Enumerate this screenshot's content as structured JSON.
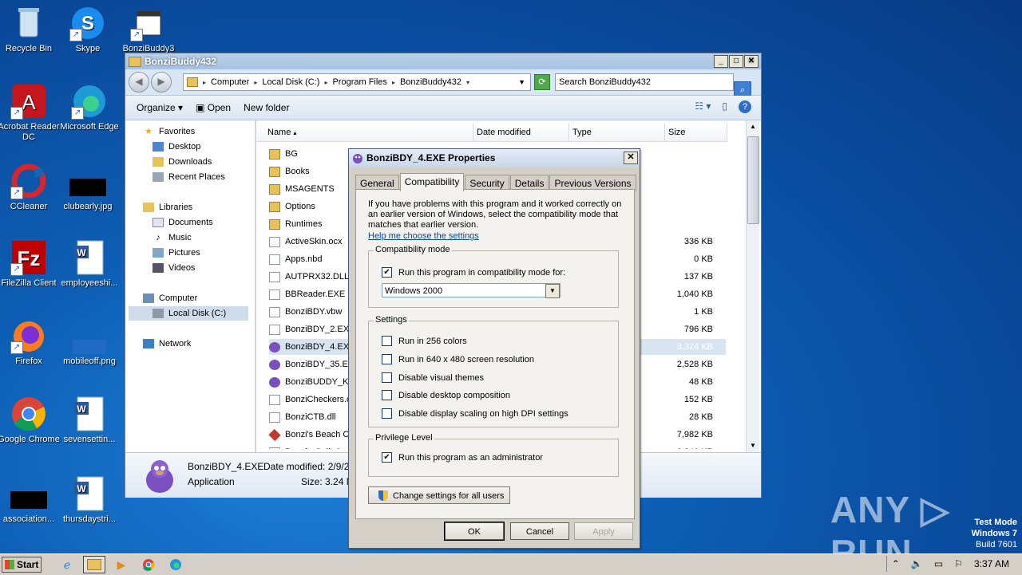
{
  "desktop": {
    "icons": [
      {
        "label": "Recycle Bin"
      },
      {
        "label": "Skype"
      },
      {
        "label": "BonziBuddy3"
      },
      {
        "label": "Acrobat Reader DC"
      },
      {
        "label": "Microsoft Edge"
      },
      {
        "label": "CCleaner"
      },
      {
        "label": "clubearly.jpg"
      },
      {
        "label": "FileZilla Client"
      },
      {
        "label": "employeeshi..."
      },
      {
        "label": "Firefox"
      },
      {
        "label": "mobileoff.png"
      },
      {
        "label": "Google Chrome"
      },
      {
        "label": "sevensettin..."
      },
      {
        "label": "association..."
      },
      {
        "label": "thursdaystri..."
      }
    ]
  },
  "watermark": {
    "brand": "ANY ▷ RUN",
    "line1": "Test Mode",
    "line2": "Windows 7",
    "line3": "Build 7601"
  },
  "explorer": {
    "title": "BonziBuddy432",
    "breadcrumbs": [
      "Computer",
      "Local Disk (C:)",
      "Program Files",
      "BonziBuddy432"
    ],
    "search_placeholder": "Search BonziBuddy432",
    "toolbar": {
      "organize": "Organize",
      "open": "Open",
      "new_folder": "New folder"
    },
    "nav": {
      "favorites": "Favorites",
      "desktop": "Desktop",
      "downloads": "Downloads",
      "recent": "Recent Places",
      "libraries": "Libraries",
      "documents": "Documents",
      "music": "Music",
      "pictures": "Pictures",
      "videos": "Videos",
      "computer": "Computer",
      "localdisk": "Local Disk (C:)",
      "network": "Network"
    },
    "columns": {
      "name": "Name",
      "date": "Date modified",
      "type": "Type",
      "size": "Size"
    },
    "files": [
      {
        "name": "BG",
        "size": "",
        "type": ""
      },
      {
        "name": "Books",
        "size": "",
        "type": ""
      },
      {
        "name": "MSAGENTS",
        "size": "",
        "type": ""
      },
      {
        "name": "Options",
        "size": "",
        "type": ""
      },
      {
        "name": "Runtimes",
        "size": "",
        "type": ""
      },
      {
        "name": "ActiveSkin.ocx",
        "size": "336 KB",
        "type": ""
      },
      {
        "name": "Apps.nbd",
        "size": "0 KB",
        "type": ""
      },
      {
        "name": "AUTPRX32.DLL",
        "size": "137 KB",
        "type": "ion"
      },
      {
        "name": "BBReader.EXE",
        "size": "1,040 KB",
        "type": ""
      },
      {
        "name": "BonziBDY.vbw",
        "size": "1 KB",
        "type": ""
      },
      {
        "name": "BonziBDY_2.EXE",
        "size": "796 KB",
        "type": ""
      },
      {
        "name": "BonziBDY_4.EXE",
        "size": "3,324 KB",
        "type": ""
      },
      {
        "name": "BonziBDY_35.EXE",
        "size": "2,528 KB",
        "type": ""
      },
      {
        "name": "BonziBUDDY_Kille",
        "size": "48 KB",
        "type": ""
      },
      {
        "name": "BonziCheckers.oc",
        "size": "152 KB",
        "type": ""
      },
      {
        "name": "BonziCTB.dll",
        "size": "28 KB",
        "type": "ion"
      },
      {
        "name": "Bonzi's Beach Ch",
        "size": "7,982 KB",
        "type": ""
      },
      {
        "name": "Bonzi's Solitaire",
        "size": "2,240 KB",
        "type": ""
      }
    ],
    "details": {
      "name": "BonziBDY_4.EXE",
      "date_label": "Date modified: 2/9/20",
      "type": "Application",
      "size_label": "Size: 3.24 M"
    }
  },
  "props": {
    "title": "BonziBDY_4.EXE Properties",
    "tabs": [
      "General",
      "Compatibility",
      "Security",
      "Details",
      "Previous Versions"
    ],
    "intro": "If you have problems with this program and it worked correctly on an earlier version of Windows, select the compatibility mode that matches that earlier version.",
    "help_link": "Help me choose the settings",
    "compat": {
      "title": "Compatibility mode",
      "checkbox": "Run this program in compatibility mode for:",
      "selected": "Windows 2000"
    },
    "settings": {
      "title": "Settings",
      "options": [
        "Run in 256 colors",
        "Run in 640 x 480 screen resolution",
        "Disable visual themes",
        "Disable desktop composition",
        "Disable display scaling on high DPI settings"
      ]
    },
    "privilege": {
      "title": "Privilege Level",
      "checkbox": "Run this program as an administrator"
    },
    "change_all": "Change settings for all users",
    "ok": "OK",
    "cancel": "Cancel",
    "apply": "Apply"
  },
  "taskbar": {
    "start": "Start",
    "time": "3:37 AM"
  }
}
